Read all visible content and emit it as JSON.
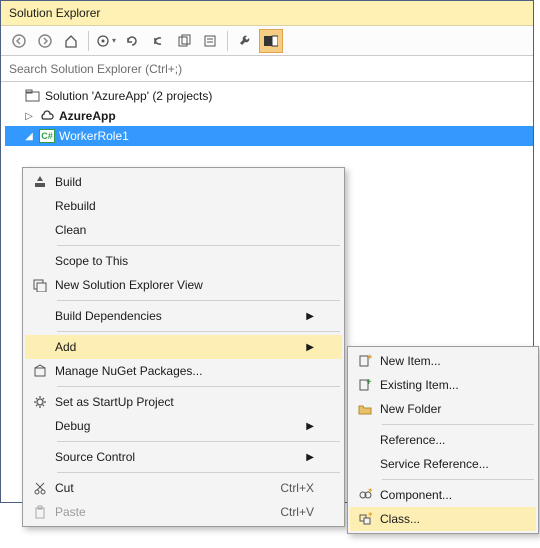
{
  "panel": {
    "title": "Solution Explorer",
    "search_placeholder": "Search Solution Explorer (Ctrl+;)"
  },
  "toolbar_buttons": [
    "back",
    "forward",
    "home",
    "sync",
    "refresh",
    "collapse",
    "show-all",
    "properties",
    "preview",
    "wrench",
    "highlight"
  ],
  "tree": {
    "solution_label": "Solution 'AzureApp' (2 projects)",
    "project_label": "AzureApp",
    "item_label": "WorkerRole1"
  },
  "ctx": {
    "build": "Build",
    "rebuild": "Rebuild",
    "clean": "Clean",
    "scope": "Scope to This",
    "newview": "New Solution Explorer View",
    "builddeps": "Build Dependencies",
    "add": "Add",
    "nuget": "Manage NuGet Packages...",
    "startup": "Set as StartUp Project",
    "debug": "Debug",
    "source": "Source Control",
    "cut": "Cut",
    "cut_sc": "Ctrl+X",
    "paste": "Paste",
    "paste_sc": "Ctrl+V"
  },
  "sub": {
    "newitem": "New Item...",
    "existing": "Existing Item...",
    "newfolder": "New Folder",
    "reference": "Reference...",
    "serviceref": "Service Reference...",
    "component": "Component...",
    "class": "Class..."
  }
}
